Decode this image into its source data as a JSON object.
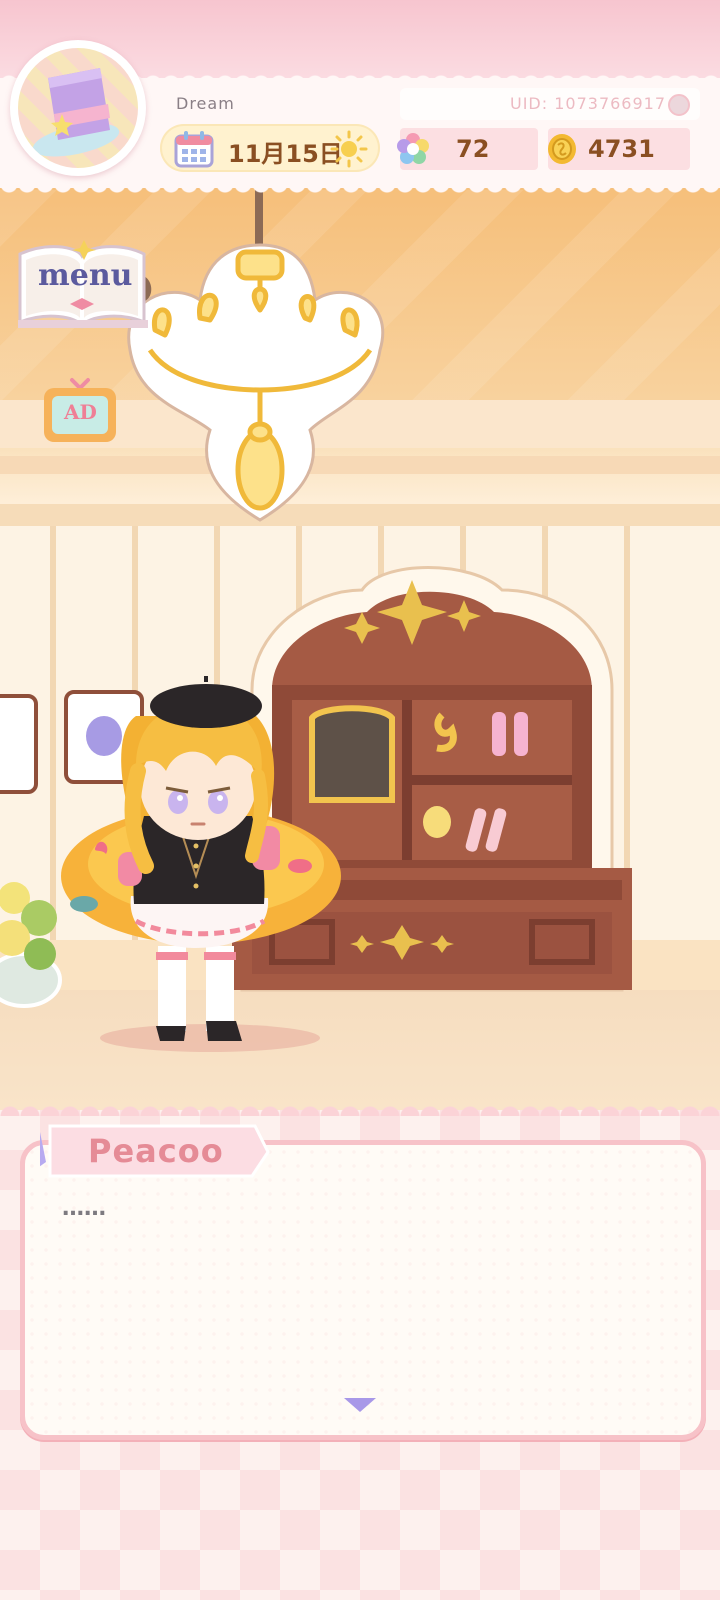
{
  "player": {
    "name": "Dream",
    "uid": "UID: 1073766917"
  },
  "date": {
    "text": "11月15日",
    "weather_icon": "sun-icon"
  },
  "currencies": [
    {
      "icon": "rainbow-flower-icon",
      "value": "72"
    },
    {
      "icon": "gold-coin-icon",
      "value": "4731"
    }
  ],
  "side_buttons": {
    "menu_label": "menu",
    "ad_label": "AD"
  },
  "dialog": {
    "speaker": "Peacoo",
    "text": "……"
  },
  "colors": {
    "accent_pink": "#f7c2c8",
    "brown_text": "#8a4f22",
    "next_arrow": "#a898e8"
  }
}
